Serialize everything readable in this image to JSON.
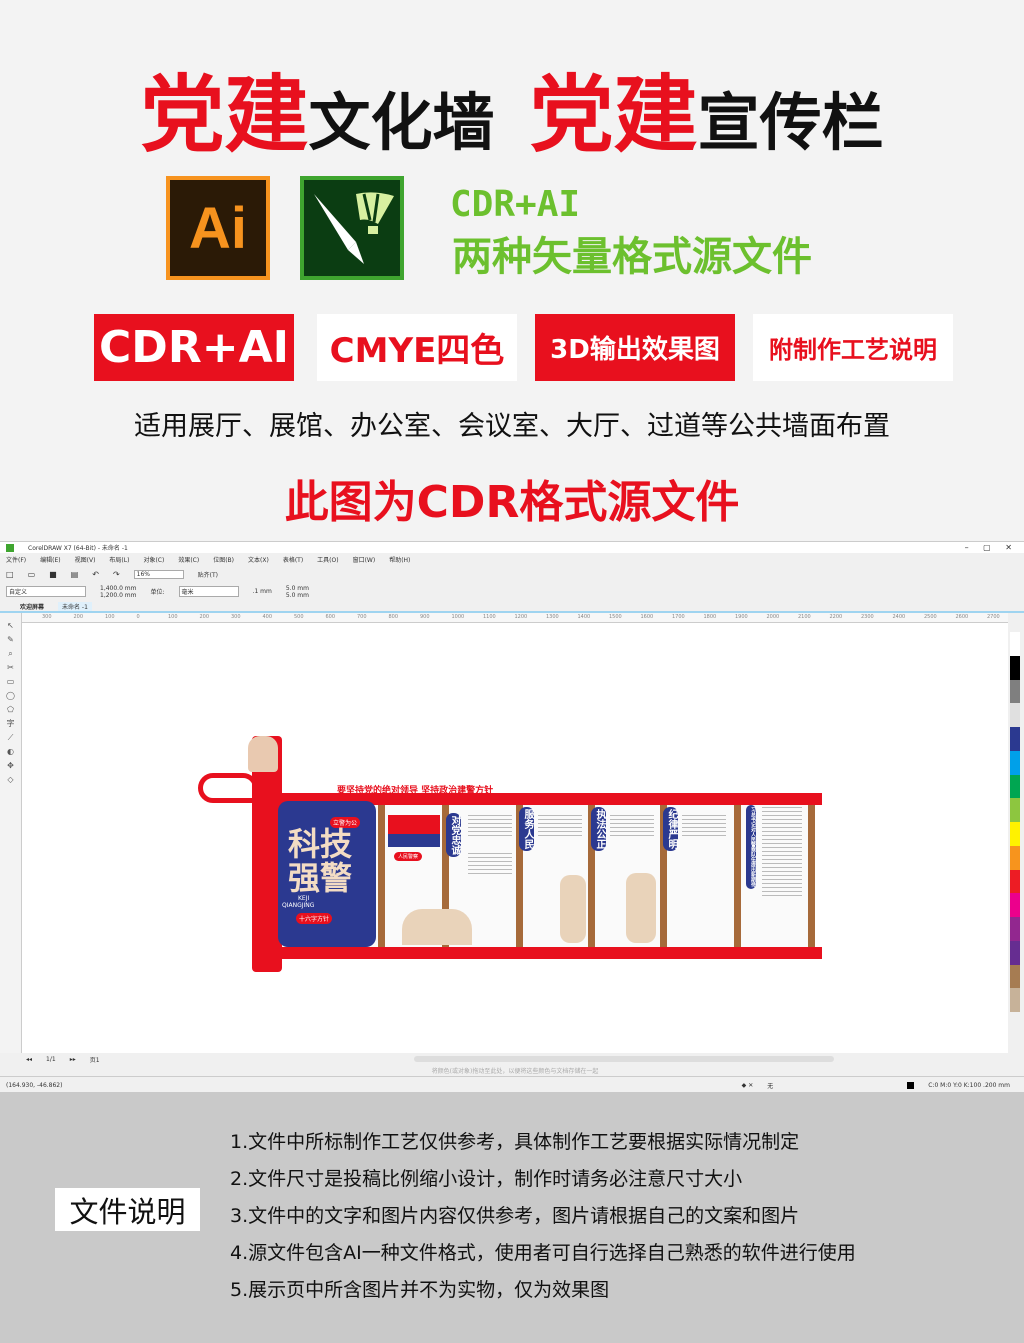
{
  "title": {
    "part1": "党建",
    "part2": "文化墙",
    "part3": "党建",
    "part4": "宣传栏"
  },
  "logos": {
    "ai_label": "Ai",
    "ai_color": "#f7931e",
    "cdr_color": "#3fa52f"
  },
  "formats": {
    "line1": "CDR+AI",
    "line2": "两种矢量格式源文件"
  },
  "badges": [
    {
      "label": "CDR+AI"
    },
    {
      "label": "CMYE四色"
    },
    {
      "label": "3D输出效果图"
    },
    {
      "label": "附制作工艺说明"
    }
  ],
  "usage": "适用展厅、展馆、办公室、会议室、大厅、过道等公共墙面布置",
  "notice": "此图为CDR格式源文件",
  "corel": {
    "window_title": "CorelDRAW X7 (64-Bit) - 未命名 -1",
    "menu": [
      "文件(F)",
      "编辑(E)",
      "视图(V)",
      "布局(L)",
      "对象(C)",
      "效果(C)",
      "位图(B)",
      "文本(X)",
      "表格(T)",
      "工具(O)",
      "窗口(W)",
      "帮助(H)"
    ],
    "zoom": "16%",
    "snap": "贴齐(T)",
    "preset": "自定义",
    "width": "1,400.0 mm",
    "height": "1,200.0 mm",
    "unit_label": "单位:",
    "unit": "毫米",
    "nudge": ".1 mm",
    "dup_x": "5.0 mm",
    "dup_y": "5.0 mm",
    "tabs": [
      "欢迎屏幕",
      "未命名 -1"
    ],
    "ruler_ticks": [
      "300",
      "200",
      "100",
      "0",
      "100",
      "200",
      "300",
      "400",
      "500",
      "600",
      "700",
      "800",
      "900",
      "1000",
      "1100",
      "1200",
      "1300",
      "1400",
      "1500",
      "1600",
      "1700",
      "1800",
      "1900",
      "2000",
      "2100",
      "2200",
      "2300",
      "2400",
      "2500",
      "2600",
      "2700"
    ],
    "page_nav": "1/1",
    "page_tab": "页1",
    "hint": "将颜色(或对象)拖动至此处，以便将这些颜色与文档存储在一起",
    "coords": "(164.930, -46.862)",
    "fill_none": "无",
    "outline": "C:0 M:0 Y:0 K:100  .200 mm",
    "palette": [
      "#ffffff",
      "#000000",
      "#7f7f7f",
      "#e0e0e0",
      "#2b3990",
      "#00a0e9",
      "#00a651",
      "#8dc63f",
      "#fff200",
      "#f7941d",
      "#ed1c24",
      "#ec008c",
      "#92278f",
      "#662d91",
      "#a67c52",
      "#c7b299"
    ]
  },
  "artwork": {
    "slogan": "要坚持党的绝对领导  坚持政治建警方针",
    "main1": "科技",
    "main2": "强警",
    "pinyin1": "KEJI",
    "pinyin2": "QIANGJING",
    "tag_top": "立警为公",
    "tag_bottom": "十六字方针",
    "flag_label": "人民警察",
    "sections": [
      "对党忠诚",
      "服务人民",
      "执法公正",
      "纪律严明",
      "习总书记对人民警察队伍提出新期待"
    ]
  },
  "doc": {
    "label": "文件说明",
    "items": [
      "1.文件中所标制作工艺仅供参考，具体制作工艺要根据实际情况制定",
      "2.文件尺寸是投稿比例缩小设计，制作时请务必注意尺寸大小",
      "3.文件中的文字和图片内容仅供参考，图片请根据自己的文案和图片",
      "4.源文件包含AI一种文件格式，使用者可自行选择自己熟悉的软件进行使用",
      "5.展示页中所含图片并不为实物，仅为效果图"
    ]
  }
}
